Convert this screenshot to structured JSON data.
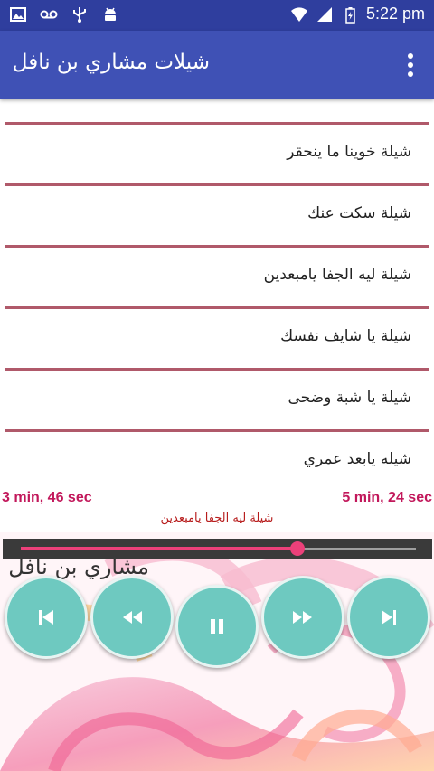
{
  "status_bar": {
    "time": "5:22 pm",
    "left_icons": [
      "image-icon",
      "voicemail-icon",
      "usb-icon",
      "android-icon"
    ],
    "right_icons": [
      "wifi-icon",
      "signal-icon",
      "battery-charging-icon"
    ]
  },
  "app_bar": {
    "title": "شيلات مشاري بن نافل",
    "menu_icon": "more-vert-icon"
  },
  "track_list": [
    {
      "title": "شيلة خوينا ما ينحقر"
    },
    {
      "title": "شيلة سكت عنك"
    },
    {
      "title": "شيلة ليه الجفا يامبعدين"
    },
    {
      "title": "شيلة يا شايف نفسك"
    },
    {
      "title": "شيلة يا شبة وضحى"
    },
    {
      "title": "شيله يابعد عمري"
    }
  ],
  "player": {
    "elapsed": "3 min, 46 sec",
    "duration": "5 min, 24 sec",
    "now_playing": "شيلة ليه الجفا يامبعدين",
    "progress_fraction": 0.7,
    "artwork_text": "مشاري بن نافل",
    "controls": [
      "skip-previous-icon",
      "rewind-icon",
      "pause-icon",
      "fast-forward-icon",
      "skip-next-icon"
    ],
    "colors": {
      "accent": "#ec407a",
      "button": "#6ec9c0",
      "time_text": "#c2185b"
    }
  },
  "colors": {
    "status_bar": "#2f3e9e",
    "app_bar": "#3f51b5",
    "divider": "#b0596a"
  }
}
